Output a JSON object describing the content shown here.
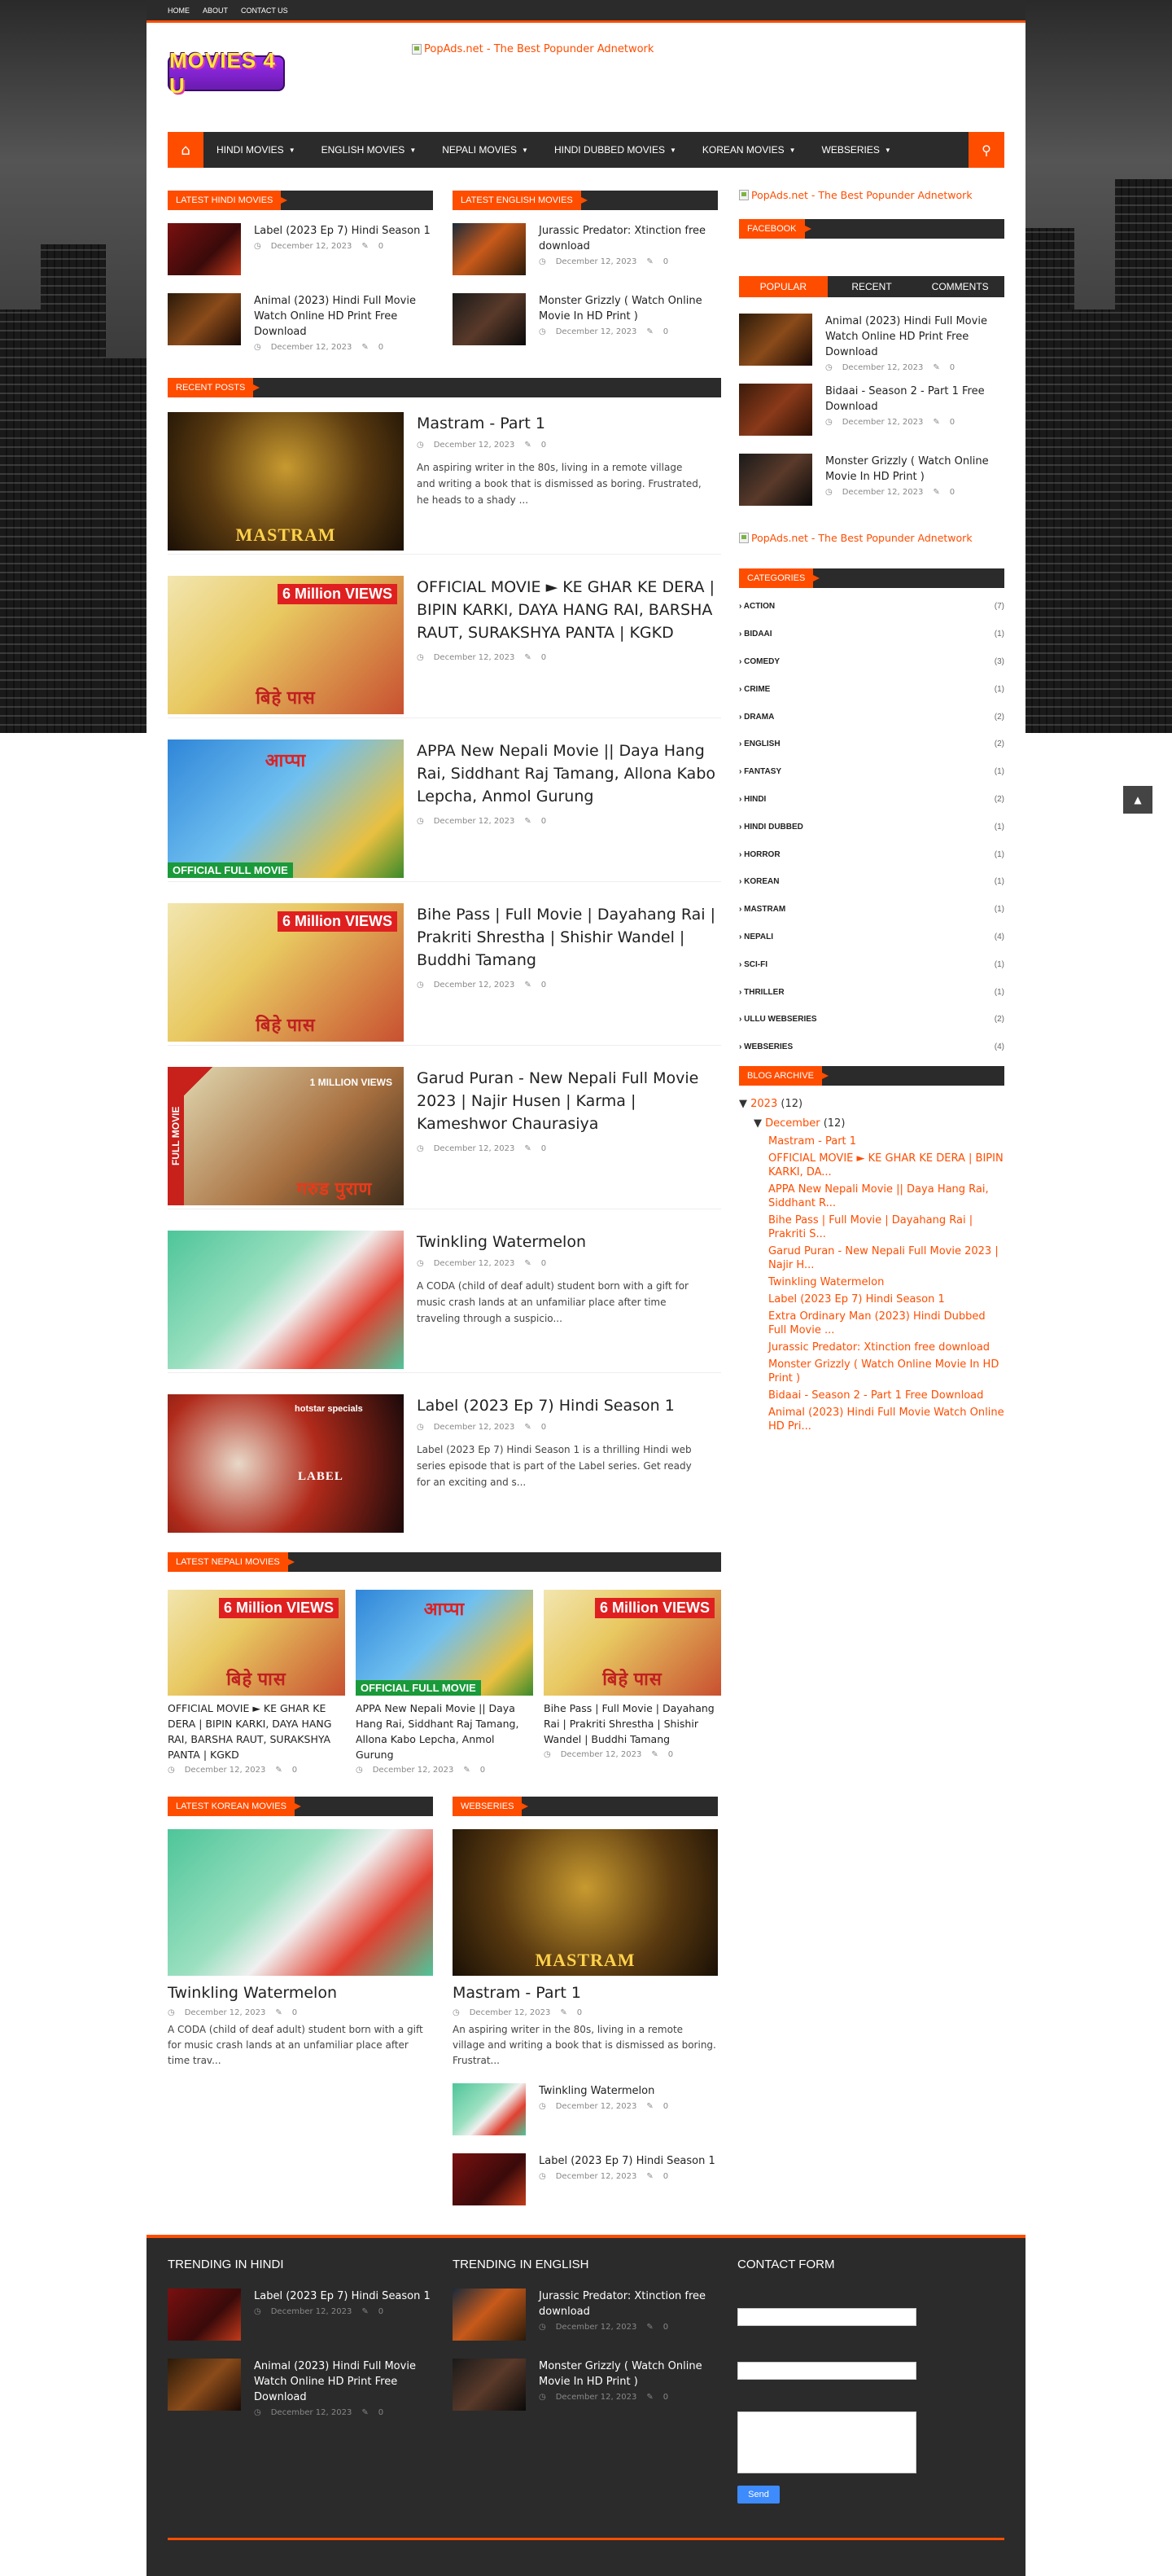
{
  "colors": {
    "accent": "#ff4d00",
    "dark": "#2b2b2b",
    "send": "#3d8bfd"
  },
  "topbar": [
    "HOME",
    "ABOUT",
    "CONTACT US"
  ],
  "logo": "MOVIES 4 U",
  "ad_text": "PopAds.net - The Best Popunder Adnetwork",
  "nav": {
    "items": [
      "HINDI MOVIES",
      "ENGLISH MOVIES",
      "NEPALI MOVIES",
      "HINDI DUBBED MOVIES",
      "KOREAN MOVIES",
      "WEBSERIES"
    ],
    "home_icon": "home-icon",
    "search_icon": "search-icon"
  },
  "date": "December 12, 2023",
  "comments": "0",
  "latest_hindi": {
    "heading": "LATEST HINDI MOVIES",
    "items": [
      "Label (2023 Ep 7) Hindi Season 1",
      "Animal (2023) Hindi Full Movie Watch Online HD Print Free Download"
    ]
  },
  "latest_english": {
    "heading": "LATEST ENGLISH MOVIES",
    "items": [
      "Jurassic Predator: Xtinction free download",
      "Monster Grizzly ( Watch Online Movie In HD Print )"
    ]
  },
  "recent": {
    "heading": "RECENT POSTS",
    "posts": [
      {
        "title": "Mastram - Part 1",
        "snippet": "An aspiring writer in the 80s, living in a remote village and writing a book that is dismissed as boring. Frustrated, he heads to a shady ..."
      },
      {
        "title": "OFFICIAL MOVIE ► KE GHAR KE DERA | BIPIN KARKI, DAYA HANG RAI, BARSHA RAUT, SURAKSHYA PANTA | KGKD",
        "snippet": ""
      },
      {
        "title": "APPA New Nepali Movie || Daya Hang Rai, Siddhant Raj Tamang, Allona Kabo Lepcha, Anmol Gurung",
        "snippet": ""
      },
      {
        "title": "Bihe Pass | Full Movie | Dayahang Rai | Prakriti Shrestha | Shishir Wandel | Buddhi Tamang",
        "snippet": ""
      },
      {
        "title": "Garud Puran - New Nepali Full Movie 2023 | Najir Husen | Karma | Kameshwor Chaurasiya",
        "snippet": ""
      },
      {
        "title": "Twinkling Watermelon",
        "snippet": "A CODA (child of deaf adult) student born with a gift for music crash lands at an unfamiliar place after time traveling through a suspicio..."
      },
      {
        "title": "Label (2023 Ep 7) Hindi Season 1",
        "snippet": "Label (2023 Ep 7) Hindi Season 1 is a thrilling Hindi web series episode that is part of the Label series. Get ready for an exciting and s..."
      }
    ]
  },
  "thumb_text": {
    "mastram": "MASTRAM",
    "views6": "6 Million VIEWS",
    "bihe": "बिहे पास",
    "appa": "आप्पा",
    "official": "OFFICIAL FULL MOVIE",
    "fullmovie": "FULL MOVIE",
    "garud": "गरुड पुराण",
    "views1": "1 MILLION VIEWS",
    "hotstar": "hotstar specials",
    "label": "LABEL"
  },
  "latest_nepali": {
    "heading": "LATEST NEPALI MOVIES",
    "items": [
      "OFFICIAL MOVIE ► KE GHAR KE DERA | BIPIN KARKI, DAYA HANG RAI, BARSHA RAUT, SURAKSHYA PANTA | KGKD",
      "APPA New Nepali Movie || Daya Hang Rai, Siddhant Raj Tamang, Allona Kabo Lepcha, Anmol Gurung",
      "Bihe Pass | Full Movie | Dayahang Rai | Prakriti Shrestha | Shishir Wandel | Buddhi Tamang"
    ]
  },
  "latest_korean": {
    "heading": "LATEST KOREAN MOVIES",
    "title": "Twinkling Watermelon",
    "snippet": "A CODA (child of deaf adult) student born with a gift for music crash lands at an unfamiliar place after time trav..."
  },
  "webseries": {
    "heading": "WEBSERIES",
    "title": "Mastram - Part 1",
    "snippet": "An aspiring writer in the 80s, living in a remote village and writing a book that is dismissed as boring. Frustrat...",
    "items": [
      "Twinkling Watermelon",
      "Label (2023 Ep 7) Hindi Season 1"
    ]
  },
  "sidebar": {
    "facebook": "FACEBOOK",
    "tabs": [
      "POPULAR",
      "RECENT",
      "COMMENTS"
    ],
    "popular": [
      "Animal (2023) Hindi Full Movie Watch Online HD Print Free Download",
      "Bidaai - Season 2 - Part 1 Free Download",
      "Monster Grizzly ( Watch Online Movie In HD Print )"
    ],
    "categories_heading": "CATEGORIES",
    "categories": [
      [
        "ACTION",
        "(7)"
      ],
      [
        "BIDAAI",
        "(1)"
      ],
      [
        "COMEDY",
        "(3)"
      ],
      [
        "CRIME",
        "(1)"
      ],
      [
        "DRAMA",
        "(2)"
      ],
      [
        "ENGLISH",
        "(2)"
      ],
      [
        "FANTASY",
        "(1)"
      ],
      [
        "HINDI",
        "(2)"
      ],
      [
        "HINDI DUBBED",
        "(1)"
      ],
      [
        "HORROR",
        "(1)"
      ],
      [
        "KOREAN",
        "(1)"
      ],
      [
        "MASTRAM",
        "(1)"
      ],
      [
        "NEPALI",
        "(4)"
      ],
      [
        "SCI-FI",
        "(1)"
      ],
      [
        "THRILLER",
        "(1)"
      ],
      [
        "ULLU WEBSERIES",
        "(2)"
      ],
      [
        "WEBSERIES",
        "(4)"
      ]
    ],
    "archive_heading": "BLOG ARCHIVE",
    "year": "2023",
    "year_count": "(12)",
    "month": "December",
    "month_count": "(12)",
    "archive": [
      "Mastram - Part 1",
      "OFFICIAL MOVIE ► KE GHAR KE DERA | BIPIN KARKI, DA...",
      "APPA New Nepali Movie || Daya Hang Rai, Siddhant R...",
      "Bihe Pass | Full Movie | Dayahang Rai | Prakriti S...",
      "Garud Puran - New Nepali Full Movie 2023 | Najir H...",
      "Twinkling Watermelon",
      "Label (2023 Ep 7) Hindi Season 1",
      "Extra Ordinary Man (2023) Hindi Dubbed Full Movie ...",
      "Jurassic Predator: Xtinction free download",
      "Monster Grizzly ( Watch Online Movie In HD Print )",
      "Bidaai - Season 2 - Part 1 Free Download",
      "Animal (2023) Hindi Full Movie Watch Online HD Pri..."
    ]
  },
  "footer": {
    "trend_hindi": "TRENDING IN HINDI",
    "trend_english": "TRENDING IN ENGLISH",
    "contact": "CONTACT FORM",
    "send": "Send",
    "hindi": [
      "Label (2023 Ep 7) Hindi Season 1",
      "Animal (2023) Hindi Full Movie Watch Online HD Print Free Download"
    ],
    "english": [
      "Jurassic Predator: Xtinction free download",
      "Monster Grizzly ( Watch Online Movie In HD Print )"
    ]
  }
}
